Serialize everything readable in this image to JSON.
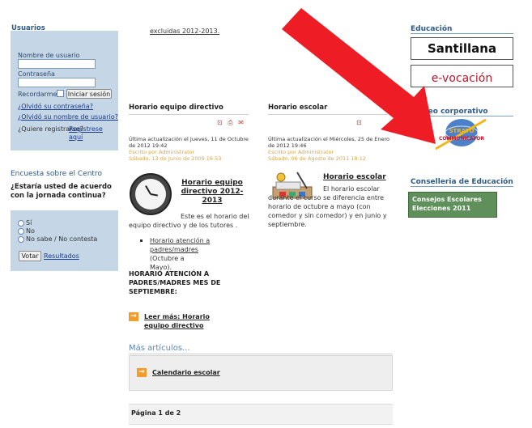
{
  "left": {
    "usuarios_title": "Usuarios",
    "username_label": "Nombre de usuario",
    "password_label": "Contraseña",
    "remember_label": "Recordarme",
    "login_button": "Iniciar sesión",
    "forgot_password": "¿Olvidó su contraseña?",
    "forgot_username": "¿Olvidó su nombre de usuario?",
    "register_prompt": "¿Quiere registrarse?",
    "register_link": "Regístrese aquí",
    "encuesta_title": "Encuesta sobre el Centro",
    "encuesta_question": "¿Estaría usted de acuerdo con la jornada continua?",
    "options": [
      "Sí",
      "No",
      "No sabe / No contesta"
    ],
    "vote_button": "Votar",
    "results_link": "Resultados"
  },
  "middle": {
    "top_link": "excluidas 2012-2013.",
    "art1": {
      "title": "Horario equipo directivo",
      "updated": "Última actualización el Jueves, 11 de Octubre de 2012 19:42",
      "author": "Escrito por Administrator",
      "date": "Sábado, 13 de Junio de 2009 16:53",
      "subtitle": "Horario equipo directivo 2012-2013",
      "text": "Este es el horario del equipo directivo y de los tutores .",
      "bullet_link": "Horario atención a padres/madres",
      "bullet_rest": "(Octubre a Mayo).",
      "bold_text": "HORARIO ATENCIÓN A PADRES/MADRES MES DE SEPTIEMBRE:",
      "read_more": "Leer más: Horario equipo directivo"
    },
    "art2": {
      "title": "Horario escolar",
      "updated": "Última actualización el Miércoles, 25 de Enero de 2012 19:46",
      "author": "Escrito por Administrator",
      "date": "Sábado, 06 de Agosto de 2011 18:12",
      "subtitle": "Horario escolar",
      "text": "El horario escolar durante el curso se diferencia entre horario de octubre a mayo (con comedor y sin comedor) y en junio y septiembre."
    },
    "mas_title": "Más artículos...",
    "calendar_link": "Calendario escolar",
    "page_label": "Página 1 de 2"
  },
  "right": {
    "educacion_title": "Educación",
    "santillana": "Santillana",
    "evocacion": "e-vocación",
    "correo_title": "Correo corporativo",
    "stratos_line1": "STRATO",
    "stratos_line2": "COMMUNICATOR",
    "conselleria_title": "Conselleria de Educación",
    "consejos_line1": "Consejos Escolares",
    "consejos_line2": "Elecciones 2011"
  },
  "colors": {
    "box_blue": "#c5d6e6",
    "heading_blue": "#2e5a8a",
    "arrow_red": "#ee1c24",
    "orange": "#f39c2a"
  }
}
